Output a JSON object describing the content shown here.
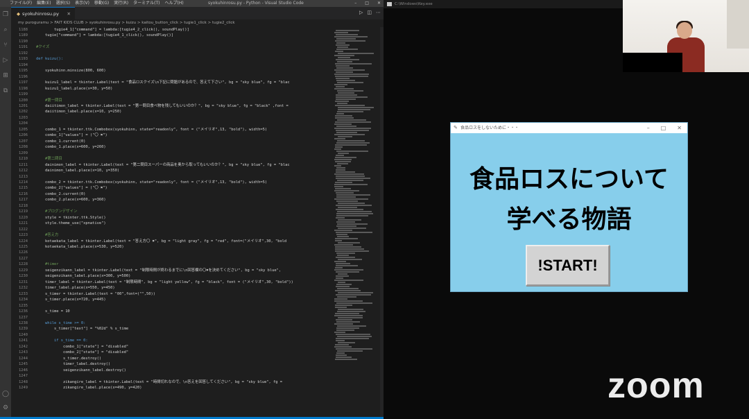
{
  "vscode": {
    "window_title": "syokuhinrosu.py - Python - Visual Studio Code",
    "menu": [
      "ファイル(F)",
      "編集(E)",
      "選択(S)",
      "表示(V)",
      "移動(G)",
      "実行(R)",
      "ターミナル(T)",
      "ヘルプ(H)"
    ],
    "tab_label": "syokuhinrosu.py",
    "breadcrumb": "my puroguramu > FAIT KIDS CLUB > syokuhinrosu.py > kuizu > kaitou_button_click > tugie1_click > tugie2_click",
    "code_lines": [
      {
        "n": "1188",
        "t": "        tugie4_1[\"command\"] = lambda:[tugie4_2_click(), soundPlay()]",
        "c": "ct"
      },
      {
        "n": "1189",
        "t": "    tugie[\"command\"] = lambda:[tugie4_1_click(), soundPlay()]",
        "c": "ct"
      },
      {
        "n": "1190",
        "t": "",
        "c": "ct"
      },
      {
        "n": "1191",
        "t": "#クイズ",
        "c": "cm"
      },
      {
        "n": "1192",
        "t": "",
        "c": "ct"
      },
      {
        "n": "1193",
        "t": "def kuizu():",
        "c": "kw"
      },
      {
        "n": "1194",
        "t": "",
        "c": "ct"
      },
      {
        "n": "1195",
        "t": "    syokuhinn.minsize(800, 600)",
        "c": "ct"
      },
      {
        "n": "1196",
        "t": "",
        "c": "ct"
      },
      {
        "n": "1197",
        "t": "    kuizu1_label = tkinter.Label(text = \"食品ロスクイズ\\n下記に問題があるので、答えて下さい\", bg = \"sky blue\", fg = \"blac",
        "c": "ct"
      },
      {
        "n": "1198",
        "t": "    kuizu1_label.place(x=30, y=50)",
        "c": "ct"
      },
      {
        "n": "1199",
        "t": "",
        "c": "ct"
      },
      {
        "n": "1200",
        "t": "    #第一問目",
        "c": "cm"
      },
      {
        "n": "1201",
        "t": "    daiitimon_label = tkinter.Label(text = \"第一問目食べ物を残してもいいのか？\", bg = \"sky blue\", fg = \"black\" ,font =",
        "c": "ct"
      },
      {
        "n": "1202",
        "t": "    daiitimon_label.place(x=10, y=250)",
        "c": "ct"
      },
      {
        "n": "1203",
        "t": "",
        "c": "ct"
      },
      {
        "n": "1204",
        "t": "",
        "c": "ct"
      },
      {
        "n": "1205",
        "t": "    combo_1 = tkinter.ttk.Combobox(syokuhinn, state=\"readonly\", font = (\"メイリオ\",13, \"bold\"), width=5)",
        "c": "ct"
      },
      {
        "n": "1206",
        "t": "    combo_1[\"values\"] = (\"〇 ✖\")",
        "c": "ct"
      },
      {
        "n": "1207",
        "t": "    combo_1.current(0)",
        "c": "ct"
      },
      {
        "n": "1208",
        "t": "    combo_1.place(x=600, y=260)",
        "c": "ct"
      },
      {
        "n": "1209",
        "t": "",
        "c": "ct"
      },
      {
        "n": "1210",
        "t": "    #第二問目",
        "c": "cm"
      },
      {
        "n": "1211",
        "t": "    dainimon_label = tkinter.Label(text = \"第二問目スーパーの商品を奥から取ってもいいのか？\", bg = \"sky blue\", fg = \"blac",
        "c": "ct"
      },
      {
        "n": "1212",
        "t": "    dainimon_label.place(x=10, y=350)",
        "c": "ct"
      },
      {
        "n": "1213",
        "t": "",
        "c": "ct"
      },
      {
        "n": "1214",
        "t": "    combo_2 = tkinter.ttk.Combobox(syokuhinn, state=\"readonly\", font = (\"メイリオ\",13, \"bold\"), width=5)",
        "c": "ct"
      },
      {
        "n": "1215",
        "t": "    combo_2[\"values\"] = (\"〇 ✖\")",
        "c": "ct"
      },
      {
        "n": "1216",
        "t": "    combo_2.current(0)",
        "c": "ct"
      },
      {
        "n": "1217",
        "t": "    combo_2.place(x=600, y=360)",
        "c": "ct"
      },
      {
        "n": "1218",
        "t": "",
        "c": "ct"
      },
      {
        "n": "1219",
        "t": "    #ブログンデザイン",
        "c": "cm"
      },
      {
        "n": "1220",
        "t": "    style = tkinter.ttk.Style()",
        "c": "ct"
      },
      {
        "n": "1221",
        "t": "    style.theme_use(\"xpnative\")",
        "c": "ct"
      },
      {
        "n": "1222",
        "t": "",
        "c": "ct"
      },
      {
        "n": "1223",
        "t": "    #答え方",
        "c": "cm"
      },
      {
        "n": "1224",
        "t": "    kotaekata_label = tkinter.Label(text = \"答え方〇 ✖\", bg = \"light gray\", fg = \"red\", font=(\"メイリオ\",30, \"bold",
        "c": "ct"
      },
      {
        "n": "1225",
        "t": "    kotaekata_label.place(x=530, y=520)",
        "c": "ct"
      },
      {
        "n": "1226",
        "t": "",
        "c": "ct"
      },
      {
        "n": "1227",
        "t": "",
        "c": "ct"
      },
      {
        "n": "1228",
        "t": "    #timer",
        "c": "cm"
      },
      {
        "n": "1229",
        "t": "    seigenzikann_label = tkinter.Label(text = \"制限時間が終わるまでに\\n回答欄の〇✖を決めてください\", bg = \"sky blue\",",
        "c": "ct"
      },
      {
        "n": "1230",
        "t": "    seigenzikann_label.place(x=300, y=500)",
        "c": "ct"
      },
      {
        "n": "1231",
        "t": "    timer_label = tkinter.Label(text = \"制限時間\", bg = \"light yellow\", fg = \"black\", font = (\"メイリオ\",30, \"bold\"))",
        "c": "ct"
      },
      {
        "n": "1232",
        "t": "    timer_label.place(x=550, y=450)",
        "c": "ct"
      },
      {
        "n": "1233",
        "t": "    s_timer = tkinter.Label(text = \"00\",font=(\"\",50))",
        "c": "ct"
      },
      {
        "n": "1234",
        "t": "    s_timer.place(x=720, y=445)",
        "c": "ct"
      },
      {
        "n": "1235",
        "t": "",
        "c": "ct"
      },
      {
        "n": "1236",
        "t": "    s_time = 10",
        "c": "ct"
      },
      {
        "n": "1237",
        "t": "",
        "c": "ct"
      },
      {
        "n": "1238",
        "t": "    while s_time >= 0:",
        "c": "kw"
      },
      {
        "n": "1239",
        "t": "        s_timer[\"text\"] = \"%02d\" % s_time",
        "c": "ct"
      },
      {
        "n": "1240",
        "t": "",
        "c": "ct"
      },
      {
        "n": "1241",
        "t": "        if s_time == 0:",
        "c": "kw"
      },
      {
        "n": "1242",
        "t": "            combo_1[\"state\"] = \"disabled\"",
        "c": "ct"
      },
      {
        "n": "1243",
        "t": "            combo_2[\"state\"] = \"disabled\"",
        "c": "ct"
      },
      {
        "n": "1244",
        "t": "            s_timer.destroy()",
        "c": "ct"
      },
      {
        "n": "1245",
        "t": "            timer_label.destroy()",
        "c": "ct"
      },
      {
        "n": "1246",
        "t": "            seigenzikann_label.destroy()",
        "c": "ct"
      },
      {
        "n": "1247",
        "t": "",
        "c": "ct"
      },
      {
        "n": "1248",
        "t": "            zikangire_label = tkinter.Label(text = \"時間切れなので、\\n答えを回答してください\", bg = \"sky blue\", fg =",
        "c": "ct"
      },
      {
        "n": "1249",
        "t": "            zikangire_label.place(x=490, y=420)",
        "c": "ct"
      }
    ]
  },
  "share": {
    "label": "C:\\Windows\\Key.exe"
  },
  "tk_app": {
    "window_title": "食品ロスをしないために・・・",
    "heading_line1": "食品ロスについて",
    "heading_line2": "学べる物語",
    "start_label": "!START!"
  },
  "zoom": {
    "watermark": "zoom"
  }
}
